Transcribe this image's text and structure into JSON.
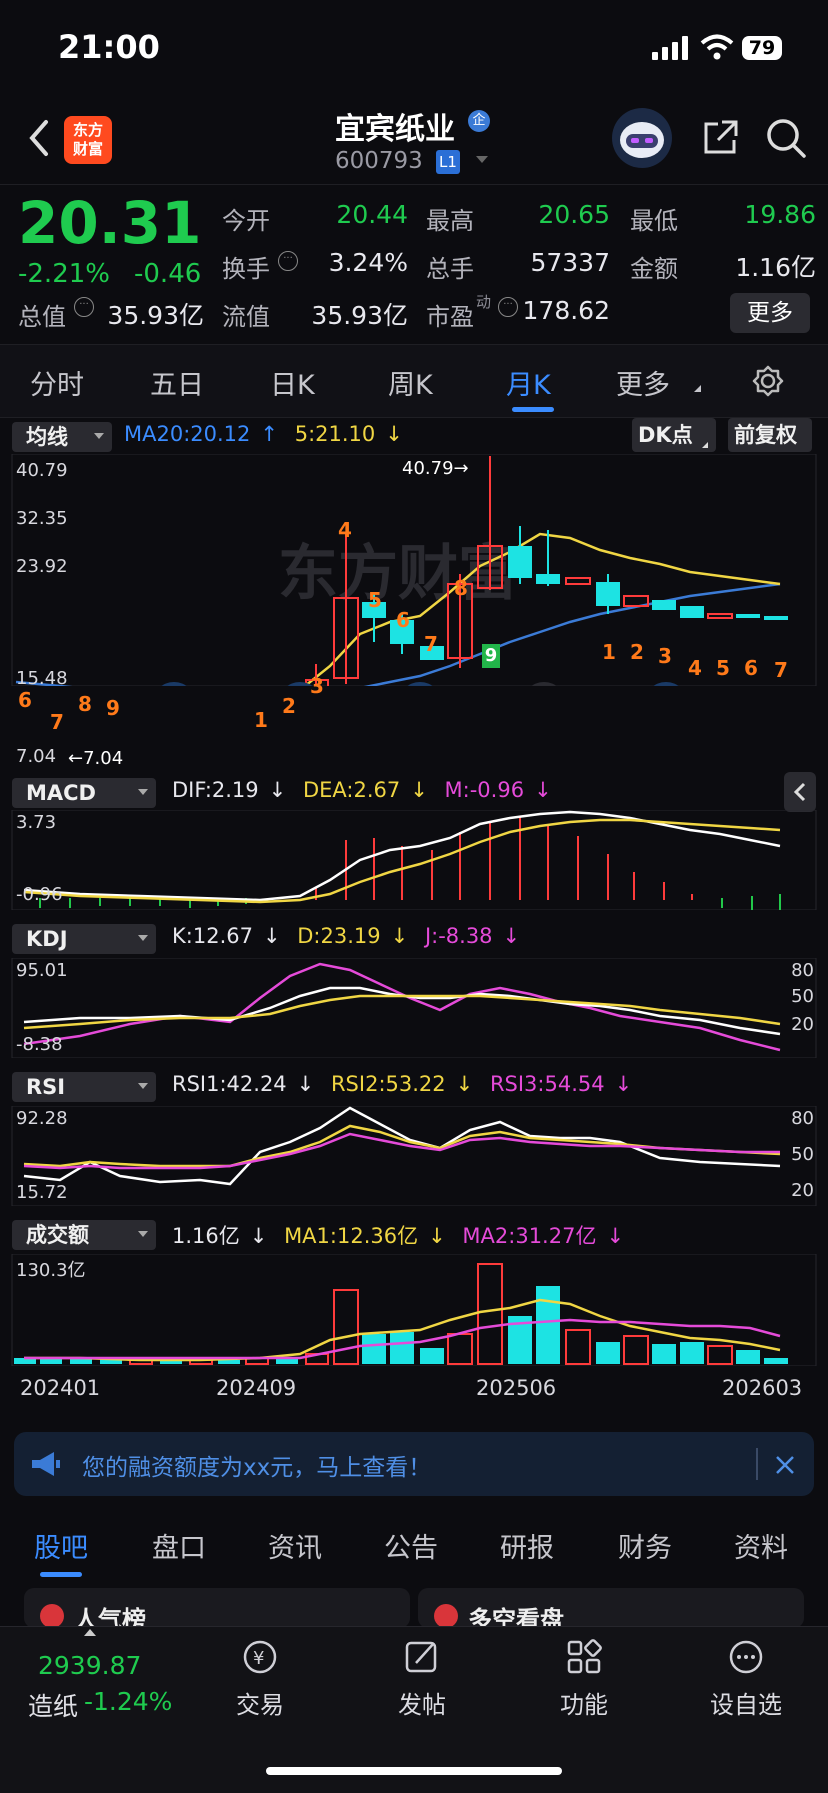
{
  "status_bar": {
    "time": "21:00",
    "battery": "79"
  },
  "header": {
    "logo_text_1": "东方",
    "logo_text_2": "财富",
    "stock_name": "宜宾纸业",
    "badge": "企",
    "stock_code": "600793",
    "level_badge": "L1"
  },
  "quote": {
    "price": "20.31",
    "change_pct": "-2.21%",
    "change": "-0.46",
    "open_label": "今开",
    "open": "20.44",
    "high_label": "最高",
    "high": "20.65",
    "low_label": "最低",
    "low": "19.86",
    "turnover_label": "换手",
    "turnover": "3.24%",
    "volume_label": "总手",
    "volume": "57337",
    "amount_label": "金额",
    "amount": "1.16亿",
    "mktcap_label": "总值",
    "mktcap": "35.93亿",
    "float_label": "流值",
    "float_cap": "35.93亿",
    "pe_label": "市盈",
    "pe_sup": "动",
    "pe": "178.62",
    "more_label": "更多"
  },
  "tabs": [
    "分时",
    "五日",
    "日K",
    "周K",
    "月K",
    "更多"
  ],
  "active_tab": "月K",
  "main_chart": {
    "indicator_label": "均线",
    "ma20_text": "MA20:20.12",
    "ma5_text": "5:21.10",
    "dk_label": "DK点",
    "adjust_label": "前复权",
    "y_labels": [
      "40.79",
      "32.35",
      "23.92",
      "15.48",
      "7.04"
    ],
    "max_note": "40.79→",
    "min_note": "←7.04",
    "watermark": "东方财富",
    "colors": {
      "up": "#ff3b3b",
      "down": "#1de3e3",
      "ma5": "#f0d644",
      "ma20": "#3b7bd6"
    }
  },
  "td_numbers": {
    "top": [
      "6",
      "7",
      "8",
      "9",
      "1",
      "2",
      "3",
      "4",
      "5",
      "6",
      "7",
      "8"
    ],
    "green_nine": "9",
    "bottom": [
      "1",
      "2",
      "3",
      "4",
      "5",
      "6",
      "7"
    ]
  },
  "macd": {
    "label": "MACD",
    "dif": "DIF:2.19",
    "dea": "DEA:2.67",
    "m": "M:-0.96",
    "y_top": "3.73",
    "y_bottom": "-0.96"
  },
  "kdj": {
    "label": "KDJ",
    "k": "K:12.67",
    "d": "D:23.19",
    "j": "J:-8.38",
    "y_top": "95.01",
    "y_bottom": "-8.38",
    "right": [
      "80",
      "50",
      "20"
    ]
  },
  "rsi": {
    "label": "RSI",
    "rsi1": "RSI1:42.24",
    "rsi2": "RSI2:53.22",
    "rsi3": "RSI3:54.54",
    "y_top": "92.28",
    "y_bottom": "15.72",
    "right": [
      "80",
      "50",
      "20"
    ]
  },
  "volume": {
    "label": "成交额",
    "v": "1.16亿",
    "ma1": "MA1:12.36亿",
    "ma2": "MA2:31.27亿",
    "y_top": "130.3亿"
  },
  "x_labels": [
    "202401",
    "202409",
    "202506",
    "202603"
  ],
  "banner": {
    "text": "您的融资额度为xx元，马上查看！"
  },
  "sub_tabs": [
    "股吧",
    "盘口",
    "资讯",
    "公告",
    "研报",
    "财务",
    "资料"
  ],
  "cards": [
    "人气榜",
    "多空看盘"
  ],
  "bottom_nav": {
    "index_value": "2939.87",
    "index_name": "造纸",
    "index_change": "-1.24%",
    "items": [
      "交易",
      "发帖",
      "功能",
      "设自选"
    ]
  }
}
